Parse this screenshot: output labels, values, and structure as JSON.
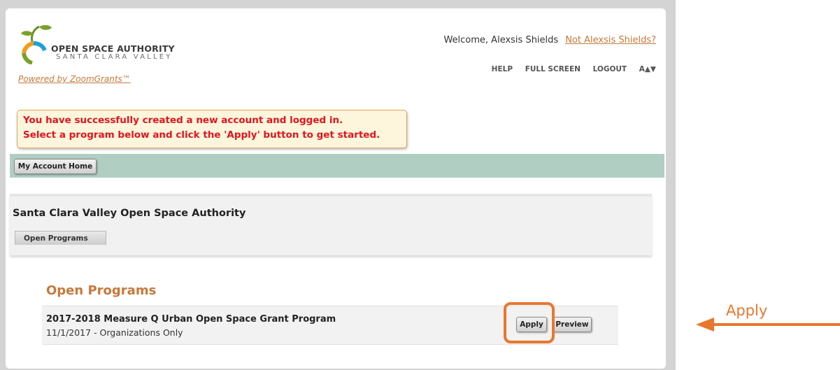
{
  "header": {
    "logo_line1": "OPEN SPACE AUTHORITY",
    "logo_line2": "SANTA CLARA VALLEY",
    "powered_by": "Powered by ZoomGrants™",
    "welcome": "Welcome, Alexsis Shields",
    "not_user": "Not Alexsis Shields?",
    "nav": {
      "help": "HELP",
      "fullscreen": "FULL SCREEN",
      "logout": "LOGOUT",
      "textsize": "A▲▼"
    }
  },
  "alert": {
    "line1": "You have successfully created a new account and logged in.",
    "line2": "Select a program below and click the 'Apply' button to get started."
  },
  "toolbar": {
    "home_label": "My Account Home"
  },
  "org": {
    "title": "Santa Clara Valley Open Space Authority",
    "tab_label": "Open Programs"
  },
  "programs": {
    "section_title": "Open Programs",
    "items": [
      {
        "name": "2017-2018 Measure Q Urban Open Space Grant Program",
        "sub": "11/1/2017 - Organizations Only",
        "apply_label": "Apply",
        "preview_label": "Preview"
      }
    ]
  },
  "annotation": {
    "label": "Apply",
    "color": "#e8772e"
  },
  "colors": {
    "accent": "#c8783a",
    "alert_text": "#e3141e",
    "bar": "#b1cec3"
  }
}
